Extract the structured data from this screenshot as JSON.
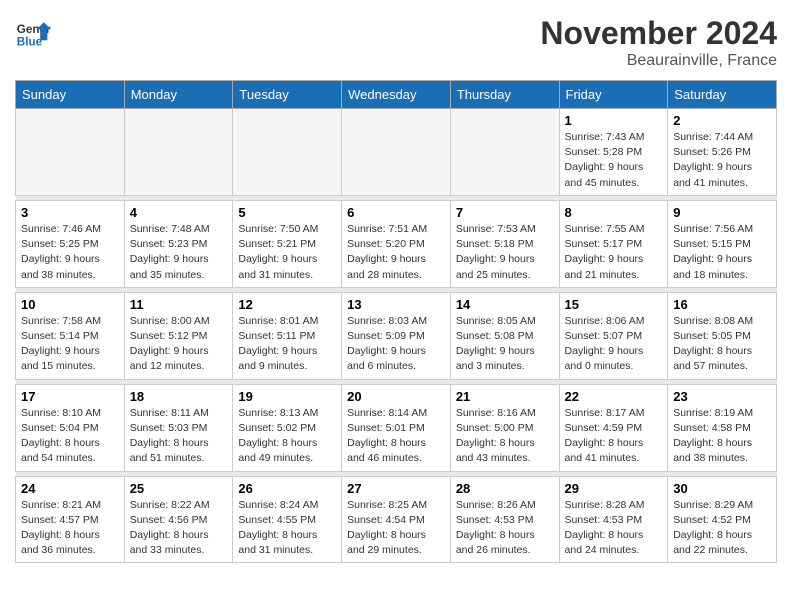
{
  "header": {
    "logo_line1": "General",
    "logo_line2": "Blue",
    "month": "November 2024",
    "location": "Beaurainville, France"
  },
  "weekdays": [
    "Sunday",
    "Monday",
    "Tuesday",
    "Wednesday",
    "Thursday",
    "Friday",
    "Saturday"
  ],
  "weeks": [
    [
      {
        "day": "",
        "info": ""
      },
      {
        "day": "",
        "info": ""
      },
      {
        "day": "",
        "info": ""
      },
      {
        "day": "",
        "info": ""
      },
      {
        "day": "",
        "info": ""
      },
      {
        "day": "1",
        "info": "Sunrise: 7:43 AM\nSunset: 5:28 PM\nDaylight: 9 hours\nand 45 minutes."
      },
      {
        "day": "2",
        "info": "Sunrise: 7:44 AM\nSunset: 5:26 PM\nDaylight: 9 hours\nand 41 minutes."
      }
    ],
    [
      {
        "day": "3",
        "info": "Sunrise: 7:46 AM\nSunset: 5:25 PM\nDaylight: 9 hours\nand 38 minutes."
      },
      {
        "day": "4",
        "info": "Sunrise: 7:48 AM\nSunset: 5:23 PM\nDaylight: 9 hours\nand 35 minutes."
      },
      {
        "day": "5",
        "info": "Sunrise: 7:50 AM\nSunset: 5:21 PM\nDaylight: 9 hours\nand 31 minutes."
      },
      {
        "day": "6",
        "info": "Sunrise: 7:51 AM\nSunset: 5:20 PM\nDaylight: 9 hours\nand 28 minutes."
      },
      {
        "day": "7",
        "info": "Sunrise: 7:53 AM\nSunset: 5:18 PM\nDaylight: 9 hours\nand 25 minutes."
      },
      {
        "day": "8",
        "info": "Sunrise: 7:55 AM\nSunset: 5:17 PM\nDaylight: 9 hours\nand 21 minutes."
      },
      {
        "day": "9",
        "info": "Sunrise: 7:56 AM\nSunset: 5:15 PM\nDaylight: 9 hours\nand 18 minutes."
      }
    ],
    [
      {
        "day": "10",
        "info": "Sunrise: 7:58 AM\nSunset: 5:14 PM\nDaylight: 9 hours\nand 15 minutes."
      },
      {
        "day": "11",
        "info": "Sunrise: 8:00 AM\nSunset: 5:12 PM\nDaylight: 9 hours\nand 12 minutes."
      },
      {
        "day": "12",
        "info": "Sunrise: 8:01 AM\nSunset: 5:11 PM\nDaylight: 9 hours\nand 9 minutes."
      },
      {
        "day": "13",
        "info": "Sunrise: 8:03 AM\nSunset: 5:09 PM\nDaylight: 9 hours\nand 6 minutes."
      },
      {
        "day": "14",
        "info": "Sunrise: 8:05 AM\nSunset: 5:08 PM\nDaylight: 9 hours\nand 3 minutes."
      },
      {
        "day": "15",
        "info": "Sunrise: 8:06 AM\nSunset: 5:07 PM\nDaylight: 9 hours\nand 0 minutes."
      },
      {
        "day": "16",
        "info": "Sunrise: 8:08 AM\nSunset: 5:05 PM\nDaylight: 8 hours\nand 57 minutes."
      }
    ],
    [
      {
        "day": "17",
        "info": "Sunrise: 8:10 AM\nSunset: 5:04 PM\nDaylight: 8 hours\nand 54 minutes."
      },
      {
        "day": "18",
        "info": "Sunrise: 8:11 AM\nSunset: 5:03 PM\nDaylight: 8 hours\nand 51 minutes."
      },
      {
        "day": "19",
        "info": "Sunrise: 8:13 AM\nSunset: 5:02 PM\nDaylight: 8 hours\nand 49 minutes."
      },
      {
        "day": "20",
        "info": "Sunrise: 8:14 AM\nSunset: 5:01 PM\nDaylight: 8 hours\nand 46 minutes."
      },
      {
        "day": "21",
        "info": "Sunrise: 8:16 AM\nSunset: 5:00 PM\nDaylight: 8 hours\nand 43 minutes."
      },
      {
        "day": "22",
        "info": "Sunrise: 8:17 AM\nSunset: 4:59 PM\nDaylight: 8 hours\nand 41 minutes."
      },
      {
        "day": "23",
        "info": "Sunrise: 8:19 AM\nSunset: 4:58 PM\nDaylight: 8 hours\nand 38 minutes."
      }
    ],
    [
      {
        "day": "24",
        "info": "Sunrise: 8:21 AM\nSunset: 4:57 PM\nDaylight: 8 hours\nand 36 minutes."
      },
      {
        "day": "25",
        "info": "Sunrise: 8:22 AM\nSunset: 4:56 PM\nDaylight: 8 hours\nand 33 minutes."
      },
      {
        "day": "26",
        "info": "Sunrise: 8:24 AM\nSunset: 4:55 PM\nDaylight: 8 hours\nand 31 minutes."
      },
      {
        "day": "27",
        "info": "Sunrise: 8:25 AM\nSunset: 4:54 PM\nDaylight: 8 hours\nand 29 minutes."
      },
      {
        "day": "28",
        "info": "Sunrise: 8:26 AM\nSunset: 4:53 PM\nDaylight: 8 hours\nand 26 minutes."
      },
      {
        "day": "29",
        "info": "Sunrise: 8:28 AM\nSunset: 4:53 PM\nDaylight: 8 hours\nand 24 minutes."
      },
      {
        "day": "30",
        "info": "Sunrise: 8:29 AM\nSunset: 4:52 PM\nDaylight: 8 hours\nand 22 minutes."
      }
    ]
  ]
}
